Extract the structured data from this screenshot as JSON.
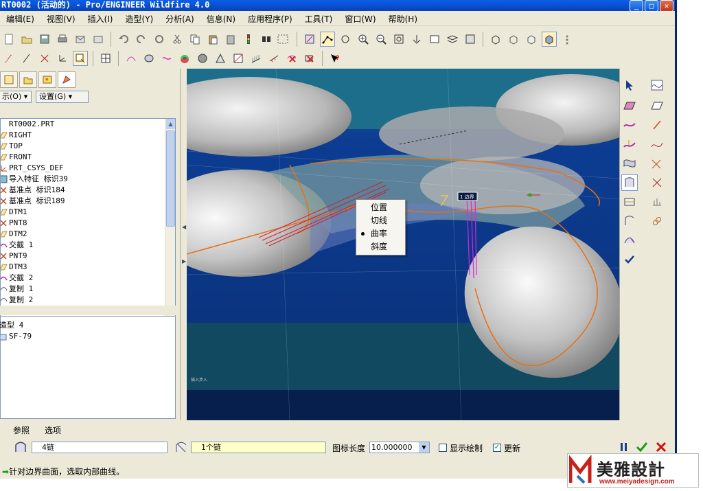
{
  "window": {
    "title": "RT0002 (活动的) - Pro/ENGINEER Wildfire 4.0",
    "minimize": "_",
    "maximize": "□",
    "close": "✕"
  },
  "menubar": {
    "items": [
      "编辑(E)",
      "视图(V)",
      "插入(I)",
      "造型(Y)",
      "分析(A)",
      "信息(N)",
      "应用程序(P)",
      "工具(T)",
      "窗口(W)",
      "帮助(H)"
    ]
  },
  "left_panel": {
    "show_dropdown": "示(O) ▾",
    "settings_dropdown": "设置(G) ▾",
    "tree_items": [
      {
        "label": "RT0002.PRT",
        "icon": "part-icon"
      },
      {
        "label": "RIGHT",
        "icon": "datum-plane-icon"
      },
      {
        "label": "TOP",
        "icon": "datum-plane-icon"
      },
      {
        "label": "FRONT",
        "icon": "datum-plane-icon"
      },
      {
        "label": "PRT_CSYS_DEF",
        "icon": "csys-icon"
      },
      {
        "label": "导入特征 标识39",
        "icon": "import-feature-icon"
      },
      {
        "label": "基准点 标识184",
        "icon": "datum-point-icon"
      },
      {
        "label": "基准点 标识189",
        "icon": "datum-point-icon"
      },
      {
        "label": "DTM1",
        "icon": "datum-plane-icon"
      },
      {
        "label": "PNT8",
        "icon": "datum-point-icon"
      },
      {
        "label": "DTM2",
        "icon": "datum-plane-icon"
      },
      {
        "label": "交截 1",
        "icon": "intersect-icon"
      },
      {
        "label": "PNT9",
        "icon": "datum-point-icon"
      },
      {
        "label": "DTM3",
        "icon": "datum-plane-icon"
      },
      {
        "label": "交截 2",
        "icon": "intersect-icon"
      },
      {
        "label": "复制 1",
        "icon": "copy-icon"
      },
      {
        "label": "复制 2",
        "icon": "copy-icon"
      }
    ],
    "lower_tree_items": [
      {
        "label": "造型 4"
      },
      {
        "label": "SF-79"
      }
    ]
  },
  "context_menu": {
    "items": [
      {
        "label": "位置",
        "selected": false
      },
      {
        "label": "切线",
        "selected": false
      },
      {
        "label": "曲率",
        "selected": true
      },
      {
        "label": "斜度",
        "selected": false
      }
    ]
  },
  "viewport": {
    "tag_label": "1 边界",
    "small_label": "插入步入"
  },
  "dashboard": {
    "tab_reference": "参照",
    "tab_options": "选项",
    "chain_field_1": "4链",
    "chain_field_2": "1个链",
    "icon_length_label": "图标长度",
    "icon_length_value": "10.000000",
    "show_draw_label": "显示绘制",
    "show_draw_checked": false,
    "update_label": "更新",
    "update_checked": true
  },
  "status": {
    "message": "针对边界曲面，选取内部曲线。"
  },
  "watermark": {
    "brand": "美雅設計",
    "url": "www.meiyadesign.com"
  },
  "colors": {
    "viewport_bg": "#0a3a88",
    "accent_orange": "#e87010",
    "magenta": "#e020e0",
    "ok_green": "#1a9a1a",
    "cancel_red": "#cc1010"
  }
}
